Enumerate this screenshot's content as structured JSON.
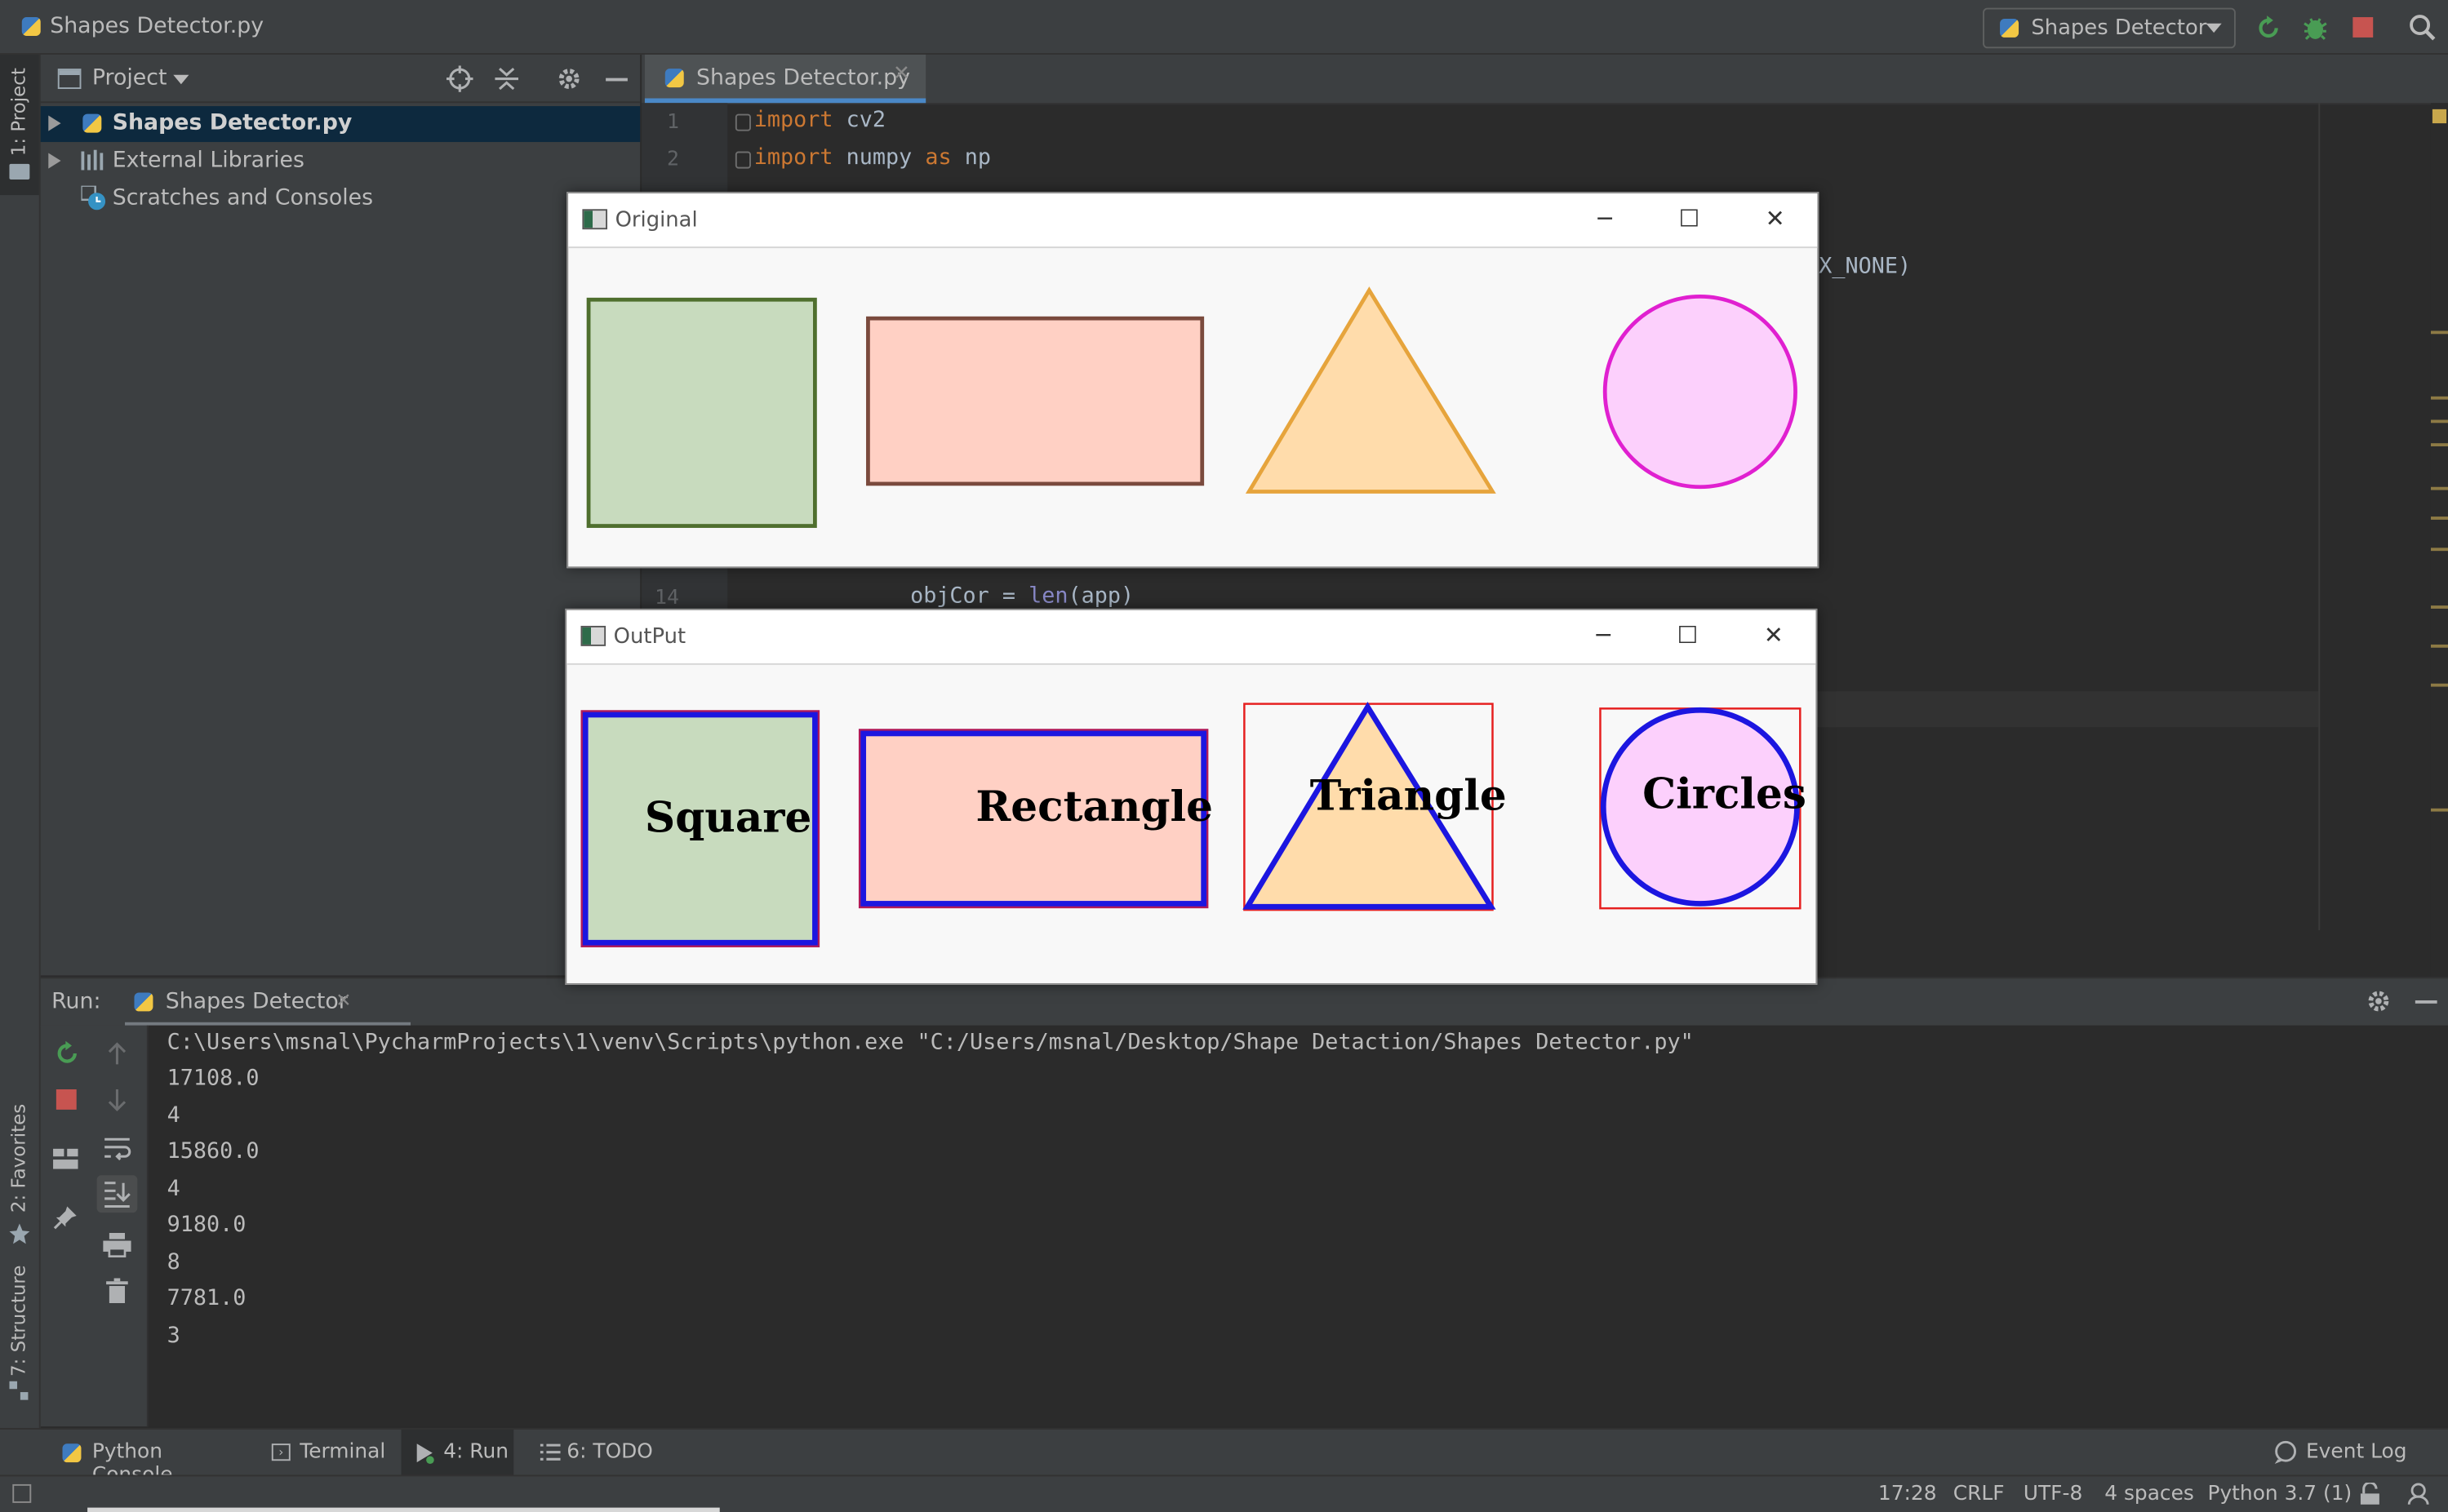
{
  "window": {
    "title": "Shapes Detector.py",
    "run_config": "Shapes Detector"
  },
  "left_strip": {
    "project_tab": "1: Project",
    "favorites_tab": "2: Favorites",
    "structure_tab": "7: Structure"
  },
  "project_panel": {
    "header": "Project",
    "items": [
      {
        "label": "Shapes Detector.py",
        "selected": true
      },
      {
        "label": "External Libraries"
      },
      {
        "label": "Scratches and Consoles"
      }
    ]
  },
  "editor": {
    "tab_label": "Shapes Detector.py",
    "lines": [
      {
        "n": "1",
        "kw": "import",
        "rest": " cv2"
      },
      {
        "n": "2",
        "kw": "import",
        "rest": " numpy ",
        "kw2": "as",
        "rest2": " np"
      }
    ],
    "visible_fragment_right": "X_NONE)",
    "line14": {
      "n": "14",
      "pre": "objCor = ",
      "fn": "len",
      "post": "(app)"
    }
  },
  "cv_windows": {
    "original": {
      "title": "Original"
    },
    "output": {
      "title": "OutPut",
      "labels": [
        "Square",
        "Rectangle",
        "Triangle",
        "Circles"
      ]
    }
  },
  "run_panel": {
    "label": "Run:",
    "tab": "Shapes Detector",
    "command": "C:\\Users\\msnal\\PycharmProjects\\1\\venv\\Scripts\\python.exe \"C:/Users/msnal/Desktop/Shape Detaction/Shapes Detector.py\"",
    "output_lines": [
      "17108.0",
      "4",
      "15860.0",
      "4",
      "9180.0",
      "8",
      "7781.0",
      "3"
    ]
  },
  "bottom_tabs": {
    "python_console": "Python Console",
    "terminal": "Terminal",
    "run": "4: Run",
    "todo": "6: TODO",
    "event_log": "Event Log"
  },
  "status": {
    "position": "17:28",
    "line_sep": "CRLF",
    "encoding": "UTF-8",
    "indent": "4 spaces",
    "interpreter": "Python 3.7 (1)"
  },
  "colors": {
    "accent": "#4a88c7",
    "run_green": "#499c54",
    "stop_red": "#c75450",
    "square_fill": "#c8dbbe",
    "rect_fill": "#ffd0c4",
    "triangle_fill": "#ffdcab",
    "circle_fill": "#fcd0fc",
    "contour_blue": "#1c16e0"
  }
}
